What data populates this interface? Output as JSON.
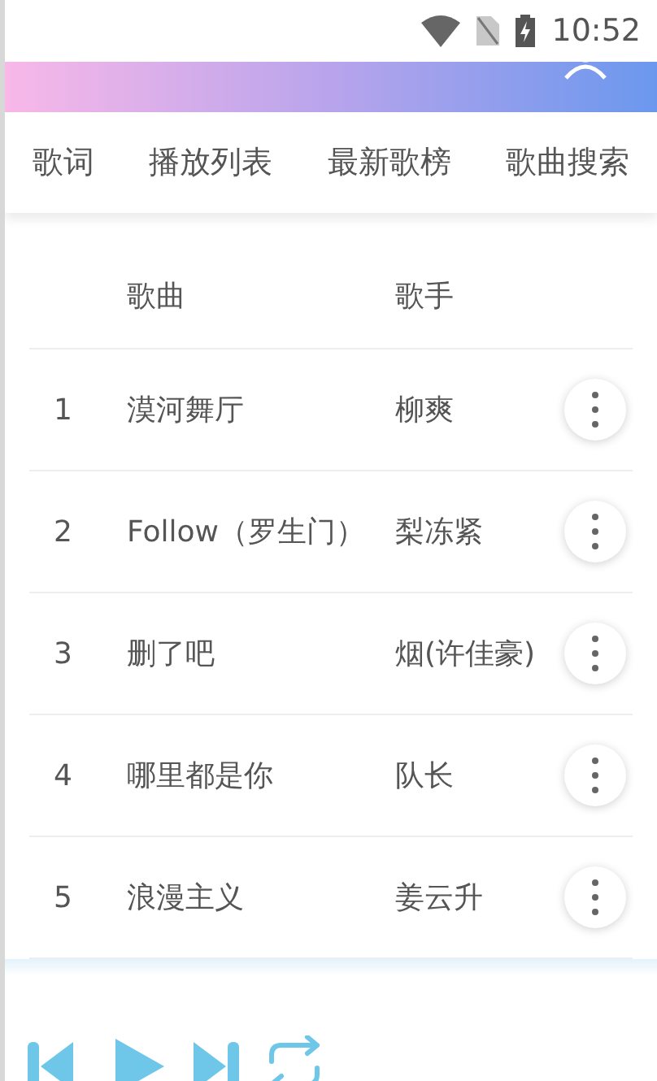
{
  "status_bar": {
    "time": "10:52"
  },
  "tabs": [
    {
      "label": "歌词",
      "selected": false
    },
    {
      "label": "播放列表",
      "selected": false
    },
    {
      "label": "最新歌榜",
      "selected": false
    },
    {
      "label": "歌曲搜索",
      "selected": false
    }
  ],
  "table": {
    "columns": [
      "歌曲",
      "歌手"
    ],
    "rows": [
      {
        "index": "1",
        "song": "漠河舞厅",
        "artist": "柳爽"
      },
      {
        "index": "2",
        "song": "Follow（罗生门）",
        "artist": "梨冻紧"
      },
      {
        "index": "3",
        "song": "删了吧",
        "artist": "烟(许佳豪)"
      },
      {
        "index": "4",
        "song": "哪里都是你",
        "artist": "队长"
      },
      {
        "index": "5",
        "song": "浪漫主义",
        "artist": "姜云升"
      }
    ]
  }
}
